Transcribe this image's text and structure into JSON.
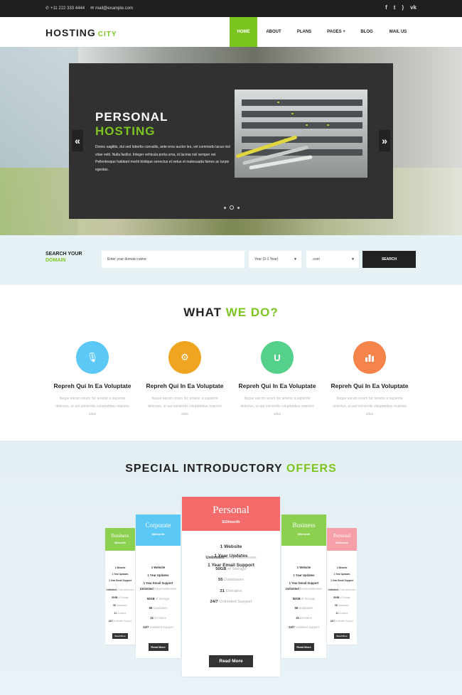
{
  "topbar": {
    "phone": "+11 222 333 4444",
    "email": "mail@example.com",
    "social": [
      "facebook-icon",
      "twitter-icon",
      "rss-icon",
      "vk-icon"
    ]
  },
  "header": {
    "logo_main": "HOSTING",
    "logo_accent": "CITY",
    "nav": [
      "HOME",
      "ABOUT",
      "PLANS",
      "PAGES +",
      "BLOG",
      "MAIL US"
    ],
    "active_index": 0
  },
  "hero": {
    "title_line1": "PERSONAL",
    "title_line2": "HOSTING",
    "text": "Donec sagittis, dui sed lobortis convallis, ante eros auctor leo, vel commodo lacus nisl vitae velit. Nulla facilisi. Integer vehicula porta urna, id lacinia nisl semper vel. Pellentesque habitant morbi tristique senectus et netus et malesuada fames ac turpis egestas.",
    "prev": "«",
    "next": "»",
    "slides_count": 3,
    "active_slide": 1
  },
  "domain_search": {
    "label_line1": "SEARCH YOUR",
    "label_line2": "DOMAIN",
    "input_placeholder": "Enter your domain name",
    "year_value": "Year (0-1 Year)",
    "tld_value": ".com",
    "button": "SEARCH"
  },
  "services": {
    "title_main": "WHAT",
    "title_accent": "WE DO?",
    "items": [
      {
        "title": "Repreh Qui In Ea Voluptate",
        "text": "Itaque earum rerum hic tenetur a sapiente delectus, ut aut reiciendis voluptatibus maiores alias",
        "icon": "microphone-icon",
        "color": "#5bc8f5"
      },
      {
        "title": "Repreh Qui In Ea Voluptate",
        "text": "Itaque earum rerum hic tenetur a sapiente delectus, ut aut reiciendis voluptatibus maiores alias",
        "icon": "gear-icon",
        "color": "#f0a520"
      },
      {
        "title": "Repreh Qui In Ea Voluptate",
        "text": "Itaque earum rerum hic tenetur a sapiente delectus, ut aut reiciendis voluptatibus maiores alias",
        "icon": "magnet-icon",
        "color": "#55d08a"
      },
      {
        "title": "Repreh Qui In Ea Voluptate",
        "text": "Itaque earum rerum hic tenetur a sapiente delectus, ut aut reiciendis voluptatibus maiores alias",
        "icon": "bar-chart-icon",
        "color": "#f5844a"
      }
    ]
  },
  "offers": {
    "title_main": "SPECIAL INTRODUCTORY",
    "title_accent": "OFFERS",
    "plans": [
      {
        "name": "Business",
        "price": "$9/month",
        "color": "#8cd04f",
        "features": [
          "1 Website",
          "1 Year Updates",
          "1 Year Email Support"
        ],
        "specs": [
          [
            "Unlimited",
            "Email Addresses"
          ],
          [
            "50GB",
            "of Storage"
          ],
          [
            "55",
            "Databases"
          ],
          [
            "21",
            "Domains"
          ],
          [
            "24/7",
            "Unlimited Support"
          ]
        ],
        "button": "Read More"
      },
      {
        "name": "Corporate",
        "price": "$8/month",
        "color": "#5bc8f5",
        "features": [
          "1 Website",
          "1 Year Updates",
          "1 Year Email Support"
        ],
        "specs": [
          [
            "Unlimited",
            "Email Addresses"
          ],
          [
            "50GB",
            "of Storage"
          ],
          [
            "55",
            "Databases"
          ],
          [
            "21",
            "Domains"
          ],
          [
            "24/7",
            "Unlimited Support"
          ]
        ],
        "button": "Read More"
      },
      {
        "name": "Personal",
        "price": "$10/month",
        "color": "#f56a6a",
        "features": [
          "1 Website",
          "1 Year Updates",
          "1 Year Email Support"
        ],
        "specs": [
          [
            "Unlimited",
            "Email Addresses"
          ],
          [
            "50GB",
            "of Storage"
          ],
          [
            "55",
            "Databases"
          ],
          [
            "21",
            "Domains"
          ],
          [
            "24/7",
            "Unlimited Support"
          ]
        ],
        "button": "Read More"
      },
      {
        "name": "Business",
        "price": "$9/month",
        "color": "#8cd04f",
        "features": [
          "1 Website",
          "1 Year Updates",
          "1 Year Email Support"
        ],
        "specs": [
          [
            "Unlimited",
            "Email Addresses"
          ],
          [
            "50GB",
            "of Storage"
          ],
          [
            "55",
            "Databases"
          ],
          [
            "21",
            "Domains"
          ],
          [
            "24/7",
            "Unlimited Support"
          ]
        ],
        "button": "Read More"
      },
      {
        "name": "Personal",
        "price": "$10/month",
        "color": "#f5a0a8",
        "features": [
          "1 Website",
          "1 Year Updates",
          "1 Year Email Support"
        ],
        "specs": [
          [
            "Unlimited",
            "Email Addresses"
          ],
          [
            "50GB",
            "of Storage"
          ],
          [
            "55",
            "Databases"
          ],
          [
            "21",
            "Domains"
          ],
          [
            "24/7",
            "Unlimited Support"
          ]
        ],
        "button": "Read More"
      }
    ]
  }
}
